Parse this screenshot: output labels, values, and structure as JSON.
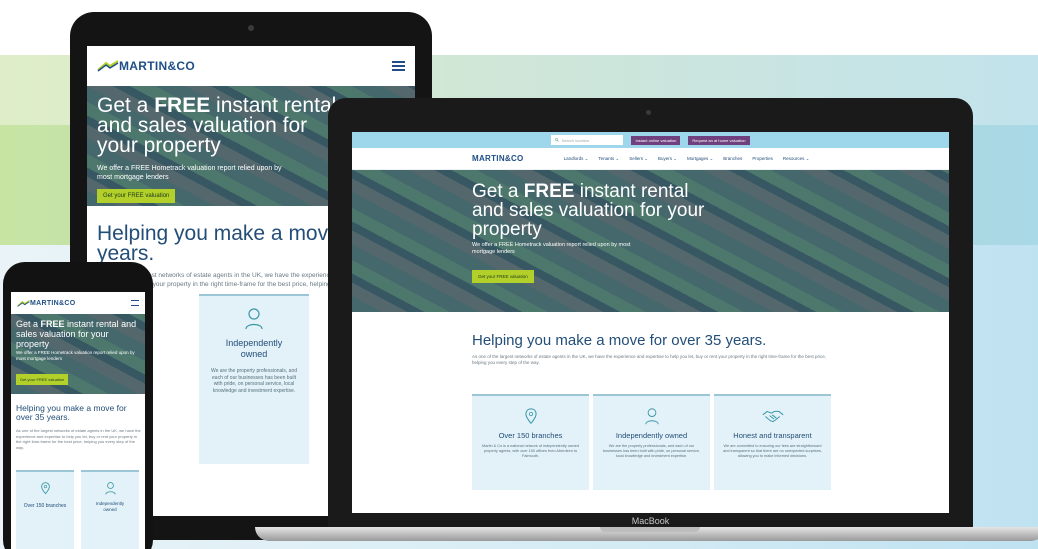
{
  "brand": {
    "logo": "MARTIN&CO",
    "accent": "#b2cf2a",
    "navy": "#234e78",
    "topbar": "#9ed7ec"
  },
  "hero": {
    "title_pre": "Get a ",
    "title_bold": "FREE",
    "title_post": " instant rental and sales valuation for your property",
    "subtitle": "We offer a FREE Hometrack valuation report relied upon by most mortgage lenders",
    "cta": "Get your FREE valuation"
  },
  "section": {
    "heading": "Helping you make a move for over 35 years.",
    "body": "As one of the largest networks of estate agents in the UK, we have the experience and expertise to help you let, buy or rent your property in the right time-frame for the best price, helping you every step of the way."
  },
  "cards": [
    {
      "title": "Over 150 branches",
      "text": "Martin & Co is a national network of independently owned property agents, with over 150 offices from Aberdeen to Falmouth.",
      "icon": "map-pin-icon"
    },
    {
      "title": "Independently owned",
      "text": "We are the property professionals, and each of our businesses has been built with pride, on personal service, local knowledge and investment expertise.",
      "icon": "person-icon"
    },
    {
      "title": "Honest and transparent",
      "text": "We are committed to ensuring our fees are straightforward and transparent so that there are no unexpected surprises, allowing you to make informed decisions.",
      "icon": "handshake-icon"
    }
  ],
  "tablet": {
    "heading": "Helping you make a move for o",
    "heading2": "years.",
    "card0_title": "branches",
    "card1_title_a": "Independently",
    "card1_title_b": "owned"
  },
  "phone": {
    "card1_title_a": "Independently",
    "card1_title_b": "owned"
  },
  "laptop": {
    "search_placeholder": "Search location",
    "btn_instant": "Instant online valuation",
    "btn_request": "Request an at home valuation",
    "nav": [
      "Landlords ⌄",
      "Tenants ⌄",
      "Sellers ⌄",
      "Buyers ⌄",
      "Mortgages ⌄",
      "Branches",
      "Properties",
      "Resources ⌄"
    ],
    "label": "MacBook"
  }
}
